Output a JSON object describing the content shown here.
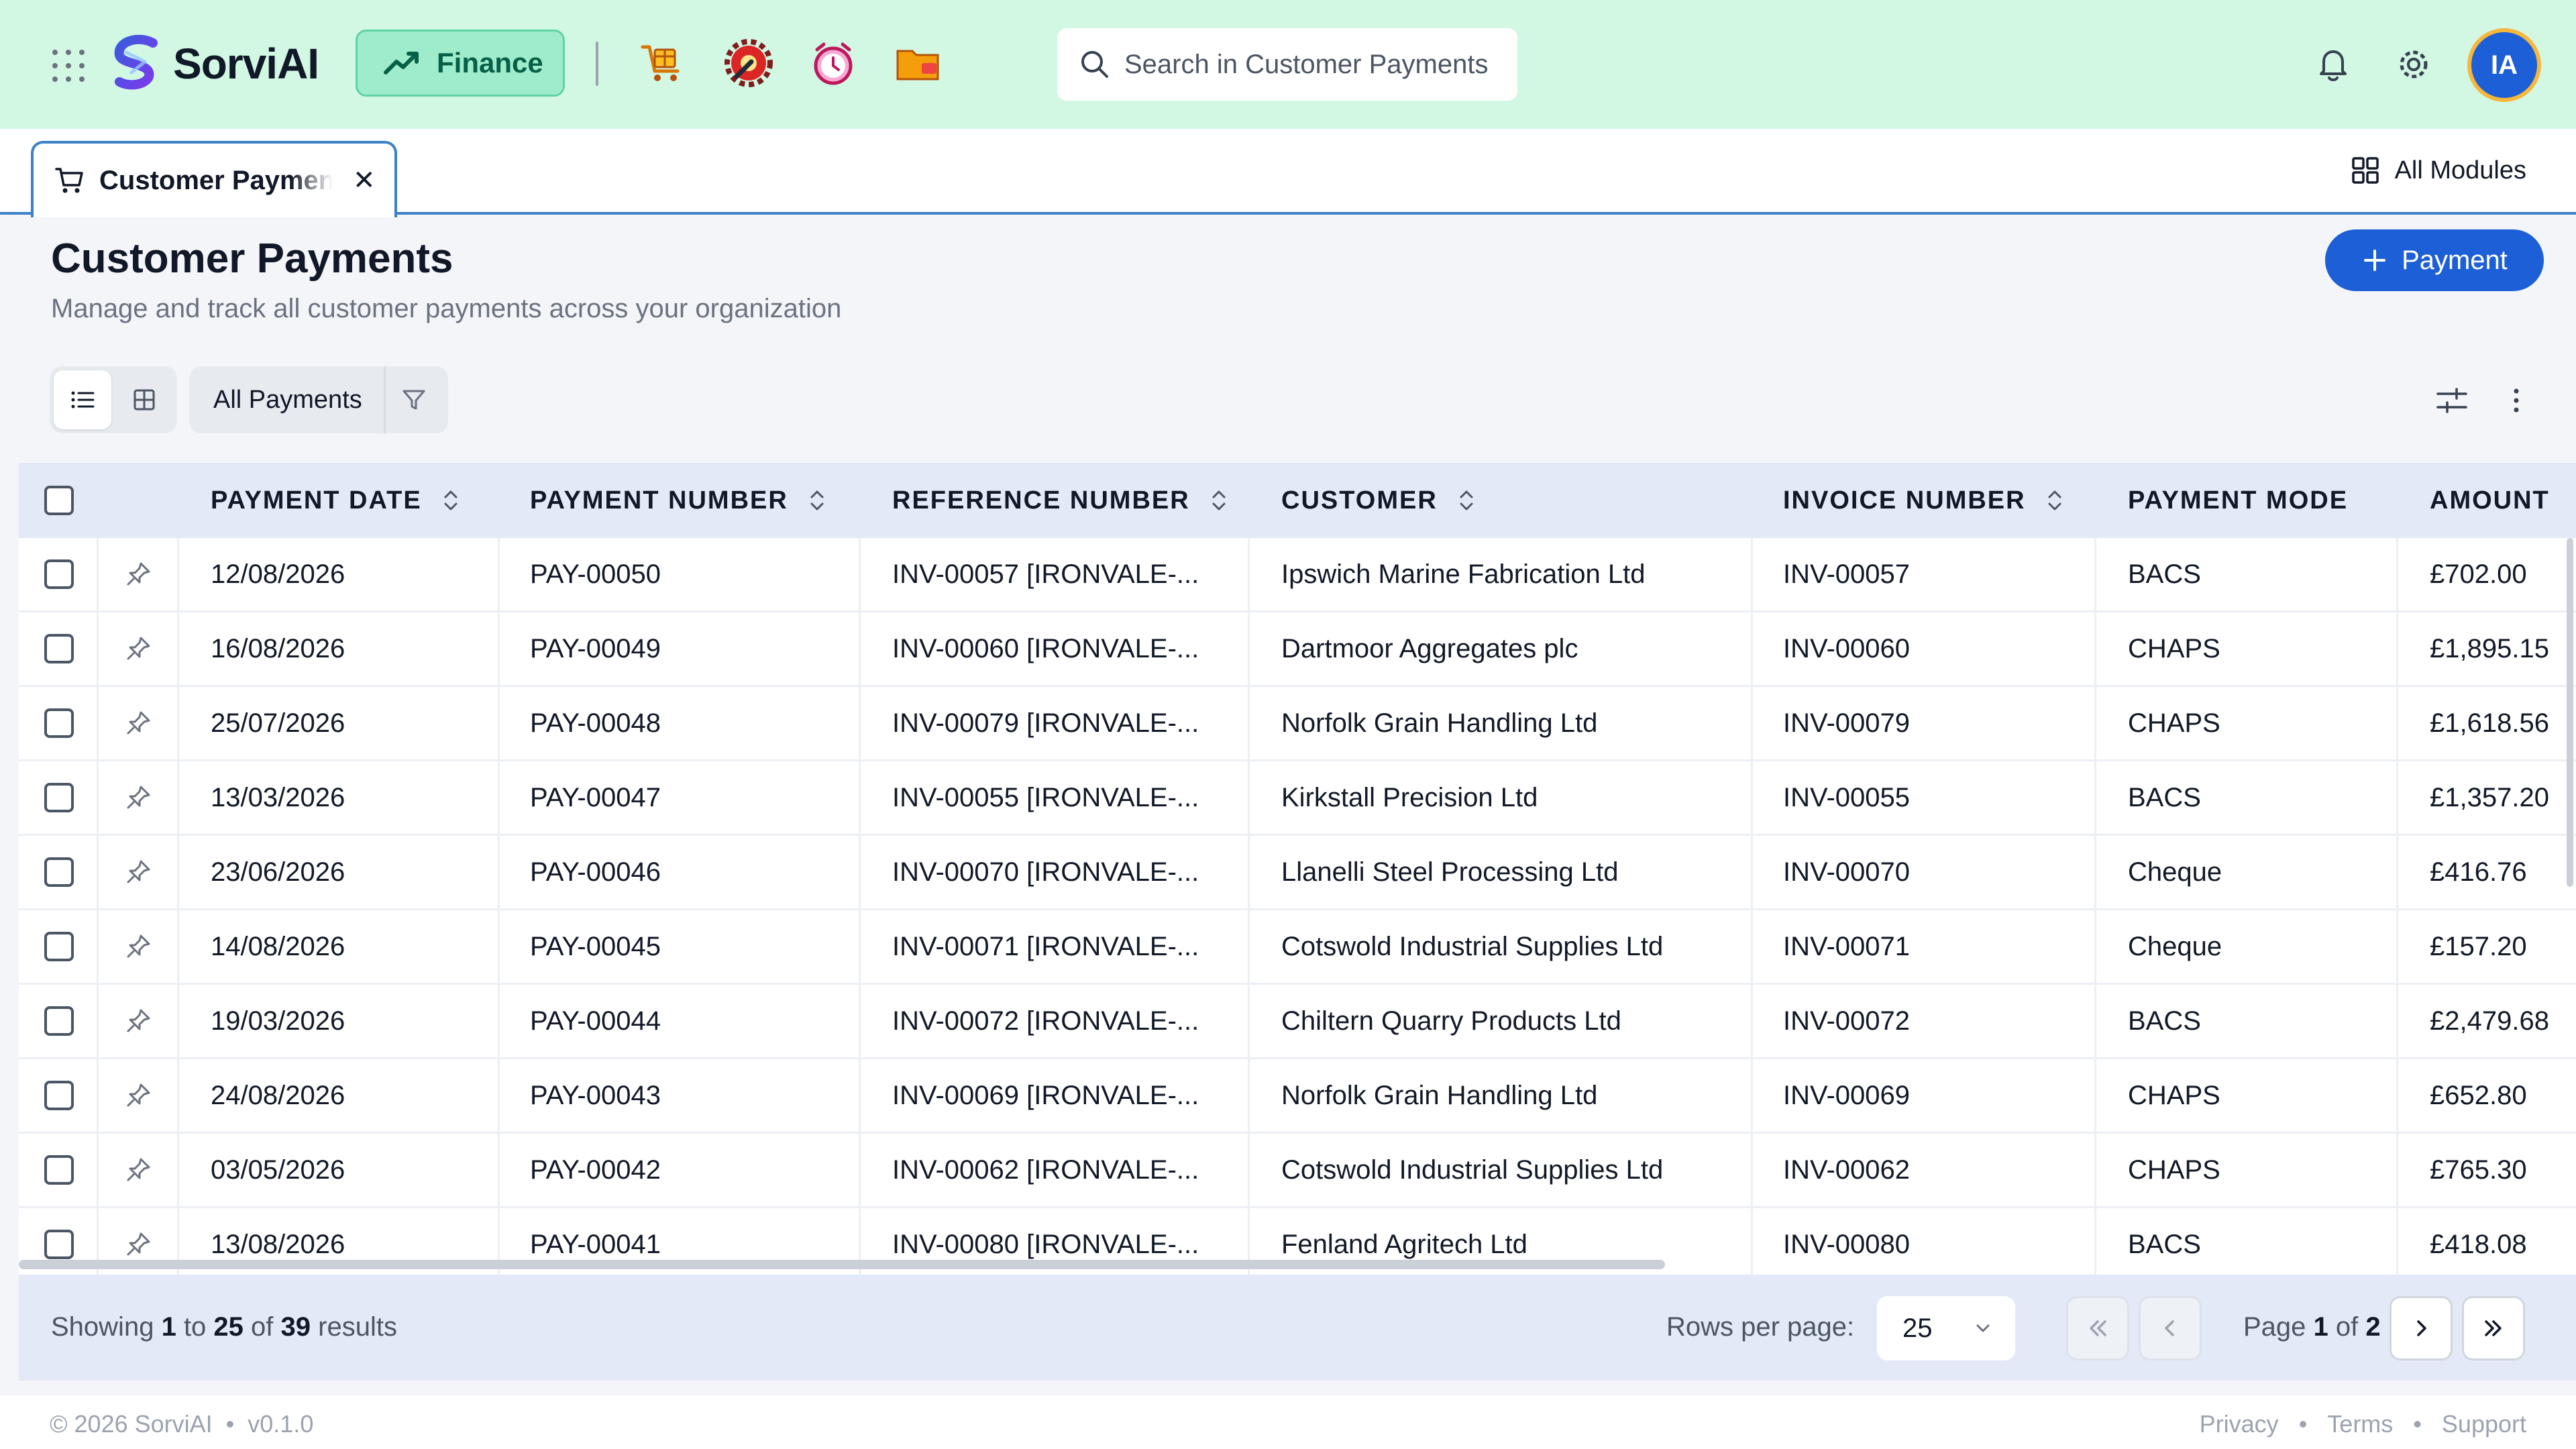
{
  "app": {
    "name": "SorviAI",
    "module": "Finance",
    "search_placeholder": "Search in Customer Payments",
    "avatar_initials": "IA",
    "accent": "#1d5fd6",
    "header_bg": "#d2f8e4"
  },
  "tabs": [
    {
      "label": "Customer Payments",
      "active": true
    }
  ],
  "all_modules_label": "All Modules",
  "page": {
    "title": "Customer Payments",
    "subtitle": "Manage and track all customer payments across your organization",
    "add_button": "Payment"
  },
  "toolbar": {
    "filter_label": "All Payments"
  },
  "table": {
    "columns": [
      "PAYMENT DATE",
      "PAYMENT NUMBER",
      "REFERENCE NUMBER",
      "CUSTOMER",
      "INVOICE NUMBER",
      "PAYMENT MODE",
      "AMOUNT"
    ],
    "rows": [
      {
        "date": "12/08/2026",
        "number": "PAY-00050",
        "reference": "INV-00057 [IRONVALE-...",
        "customer": "Ipswich Marine Fabrication Ltd",
        "invoice": "INV-00057",
        "mode": "BACS",
        "amount": "£702.00"
      },
      {
        "date": "16/08/2026",
        "number": "PAY-00049",
        "reference": "INV-00060 [IRONVALE-...",
        "customer": "Dartmoor Aggregates plc",
        "invoice": "INV-00060",
        "mode": "CHAPS",
        "amount": "£1,895.15"
      },
      {
        "date": "25/07/2026",
        "number": "PAY-00048",
        "reference": "INV-00079 [IRONVALE-...",
        "customer": "Norfolk Grain Handling Ltd",
        "invoice": "INV-00079",
        "mode": "CHAPS",
        "amount": "£1,618.56"
      },
      {
        "date": "13/03/2026",
        "number": "PAY-00047",
        "reference": "INV-00055 [IRONVALE-...",
        "customer": "Kirkstall Precision Ltd",
        "invoice": "INV-00055",
        "mode": "BACS",
        "amount": "£1,357.20"
      },
      {
        "date": "23/06/2026",
        "number": "PAY-00046",
        "reference": "INV-00070 [IRONVALE-...",
        "customer": "Llanelli Steel Processing Ltd",
        "invoice": "INV-00070",
        "mode": "Cheque",
        "amount": "£416.76"
      },
      {
        "date": "14/08/2026",
        "number": "PAY-00045",
        "reference": "INV-00071 [IRONVALE-...",
        "customer": "Cotswold Industrial Supplies Ltd",
        "invoice": "INV-00071",
        "mode": "Cheque",
        "amount": "£157.20"
      },
      {
        "date": "19/03/2026",
        "number": "PAY-00044",
        "reference": "INV-00072 [IRONVALE-...",
        "customer": "Chiltern Quarry Products Ltd",
        "invoice": "INV-00072",
        "mode": "BACS",
        "amount": "£2,479.68"
      },
      {
        "date": "24/08/2026",
        "number": "PAY-00043",
        "reference": "INV-00069 [IRONVALE-...",
        "customer": "Norfolk Grain Handling Ltd",
        "invoice": "INV-00069",
        "mode": "CHAPS",
        "amount": "£652.80"
      },
      {
        "date": "03/05/2026",
        "number": "PAY-00042",
        "reference": "INV-00062 [IRONVALE-...",
        "customer": "Cotswold Industrial Supplies Ltd",
        "invoice": "INV-00062",
        "mode": "CHAPS",
        "amount": "£765.30"
      },
      {
        "date": "13/08/2026",
        "number": "PAY-00041",
        "reference": "INV-00080 [IRONVALE-...",
        "customer": "Fenland Agritech Ltd",
        "invoice": "INV-00080",
        "mode": "BACS",
        "amount": "£418.08"
      }
    ]
  },
  "pagination": {
    "showing_prefix": "Showing",
    "from": "1",
    "to_word": "to",
    "to": "25",
    "of_word": "of",
    "total": "39",
    "results_word": "results",
    "rows_per_page_label": "Rows per page:",
    "rows_per_page": "25",
    "page_word": "Page",
    "page": "1",
    "page_of_word": "of",
    "page_total": "2"
  },
  "footer": {
    "copyright": "© 2026 SorviAI",
    "version": "v0.1.0",
    "links": [
      "Privacy",
      "Terms",
      "Support"
    ]
  }
}
